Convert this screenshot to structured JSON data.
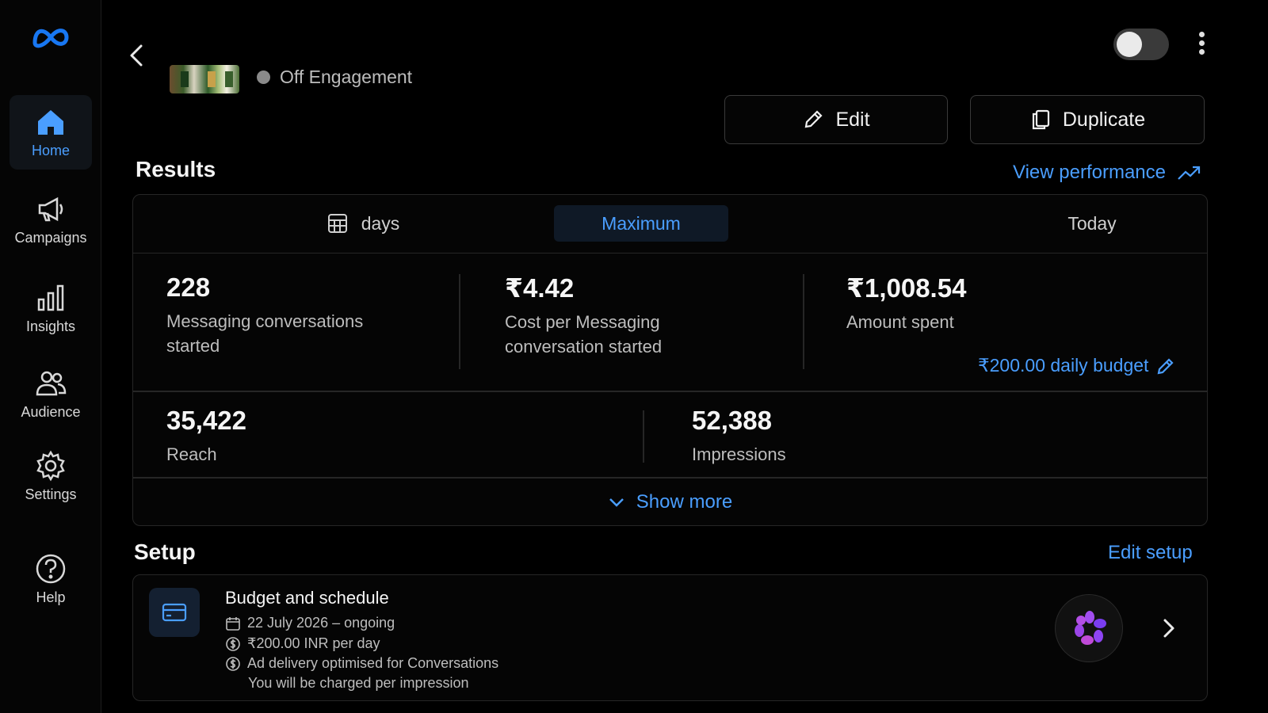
{
  "sidebar": {
    "logo_icon": "meta-logo-icon",
    "items": [
      {
        "label": "Home",
        "icon": "home-icon",
        "active": true
      },
      {
        "label": "Campaigns",
        "icon": "megaphone-icon"
      },
      {
        "label": "Insights",
        "icon": "bar-chart-icon"
      },
      {
        "label": "Audience",
        "icon": "people-icon"
      },
      {
        "label": "Settings",
        "icon": "gear-icon"
      },
      {
        "label": "Help",
        "icon": "help-circle-icon"
      }
    ]
  },
  "header": {
    "status_label": "Off Engagement",
    "toggle_on": false,
    "edit_label": "Edit",
    "duplicate_label": "Duplicate"
  },
  "results": {
    "title": "Results",
    "view_performance": "View performance",
    "tabs": [
      {
        "label": "days",
        "icon": "calendar-grid-icon"
      },
      {
        "label": "Maximum",
        "active": true
      },
      {
        "label": "Today"
      }
    ],
    "metrics": [
      {
        "value": "228",
        "label_line1": "Messaging conversations",
        "label_line2": "started"
      },
      {
        "value": "₹4.42",
        "label_line1": "Cost per Messaging",
        "label_line2": "conversation started"
      },
      {
        "value": "₹1,008.54",
        "label_line1": "Amount spent",
        "label_line2": ""
      },
      {
        "value": "35,422",
        "label_line1": "Reach",
        "label_line2": ""
      },
      {
        "value": "52,388",
        "label_line1": "Impressions",
        "label_line2": ""
      }
    ],
    "daily_budget": "₹200.00 daily budget",
    "show_more": "Show more"
  },
  "setup": {
    "title": "Setup",
    "edit_setup": "Edit setup",
    "card_title": "Budget and schedule",
    "schedule": "22 July 2026 – ongoing",
    "budget": "₹200.00 INR per day",
    "delivery": "Ad delivery optimised for Conversations",
    "charge": "You will be charged per impression"
  },
  "colors": {
    "accent": "#4a9eff",
    "background": "#000000",
    "border": "#262626"
  }
}
